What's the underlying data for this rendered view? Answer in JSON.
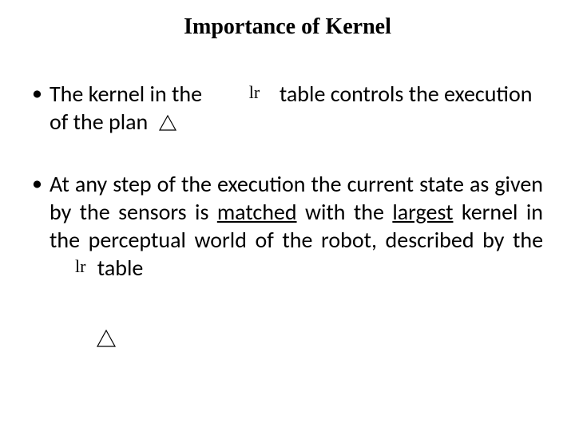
{
  "title": "Importance of Kernel",
  "bullets": {
    "b1": {
      "part1": "The kernel in the",
      "lr": "lr",
      "part2": "table controls the execution of the plan"
    },
    "b2": {
      "part1": "At any step of the execution the current state as given by the sensors is ",
      "matched": "matched",
      "part2": " with the ",
      "largest": "largest",
      "part3": " kernel in the perceptual world of the robot, described by the",
      "lr": "lr",
      "part4": "table"
    }
  }
}
